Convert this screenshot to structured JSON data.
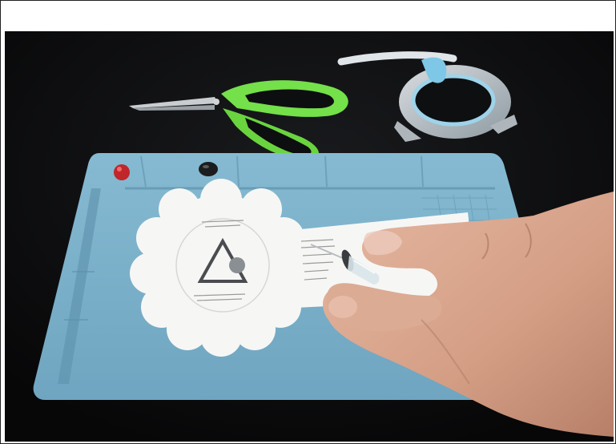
{
  "photo": {
    "subject_icons": [
      "scissors-icon",
      "tape-roll-icon",
      "silicone-mat-icon",
      "paper-template-icon",
      "push-pin-icon",
      "hand-icon"
    ],
    "colors": {
      "background": "#0b0b0c",
      "mat": "#7fb3cc",
      "mat_dark": "#5f93ad",
      "scissor_handle": "#74e04a",
      "paper": "#f6f7f5",
      "skin": "#d9a68c"
    }
  }
}
